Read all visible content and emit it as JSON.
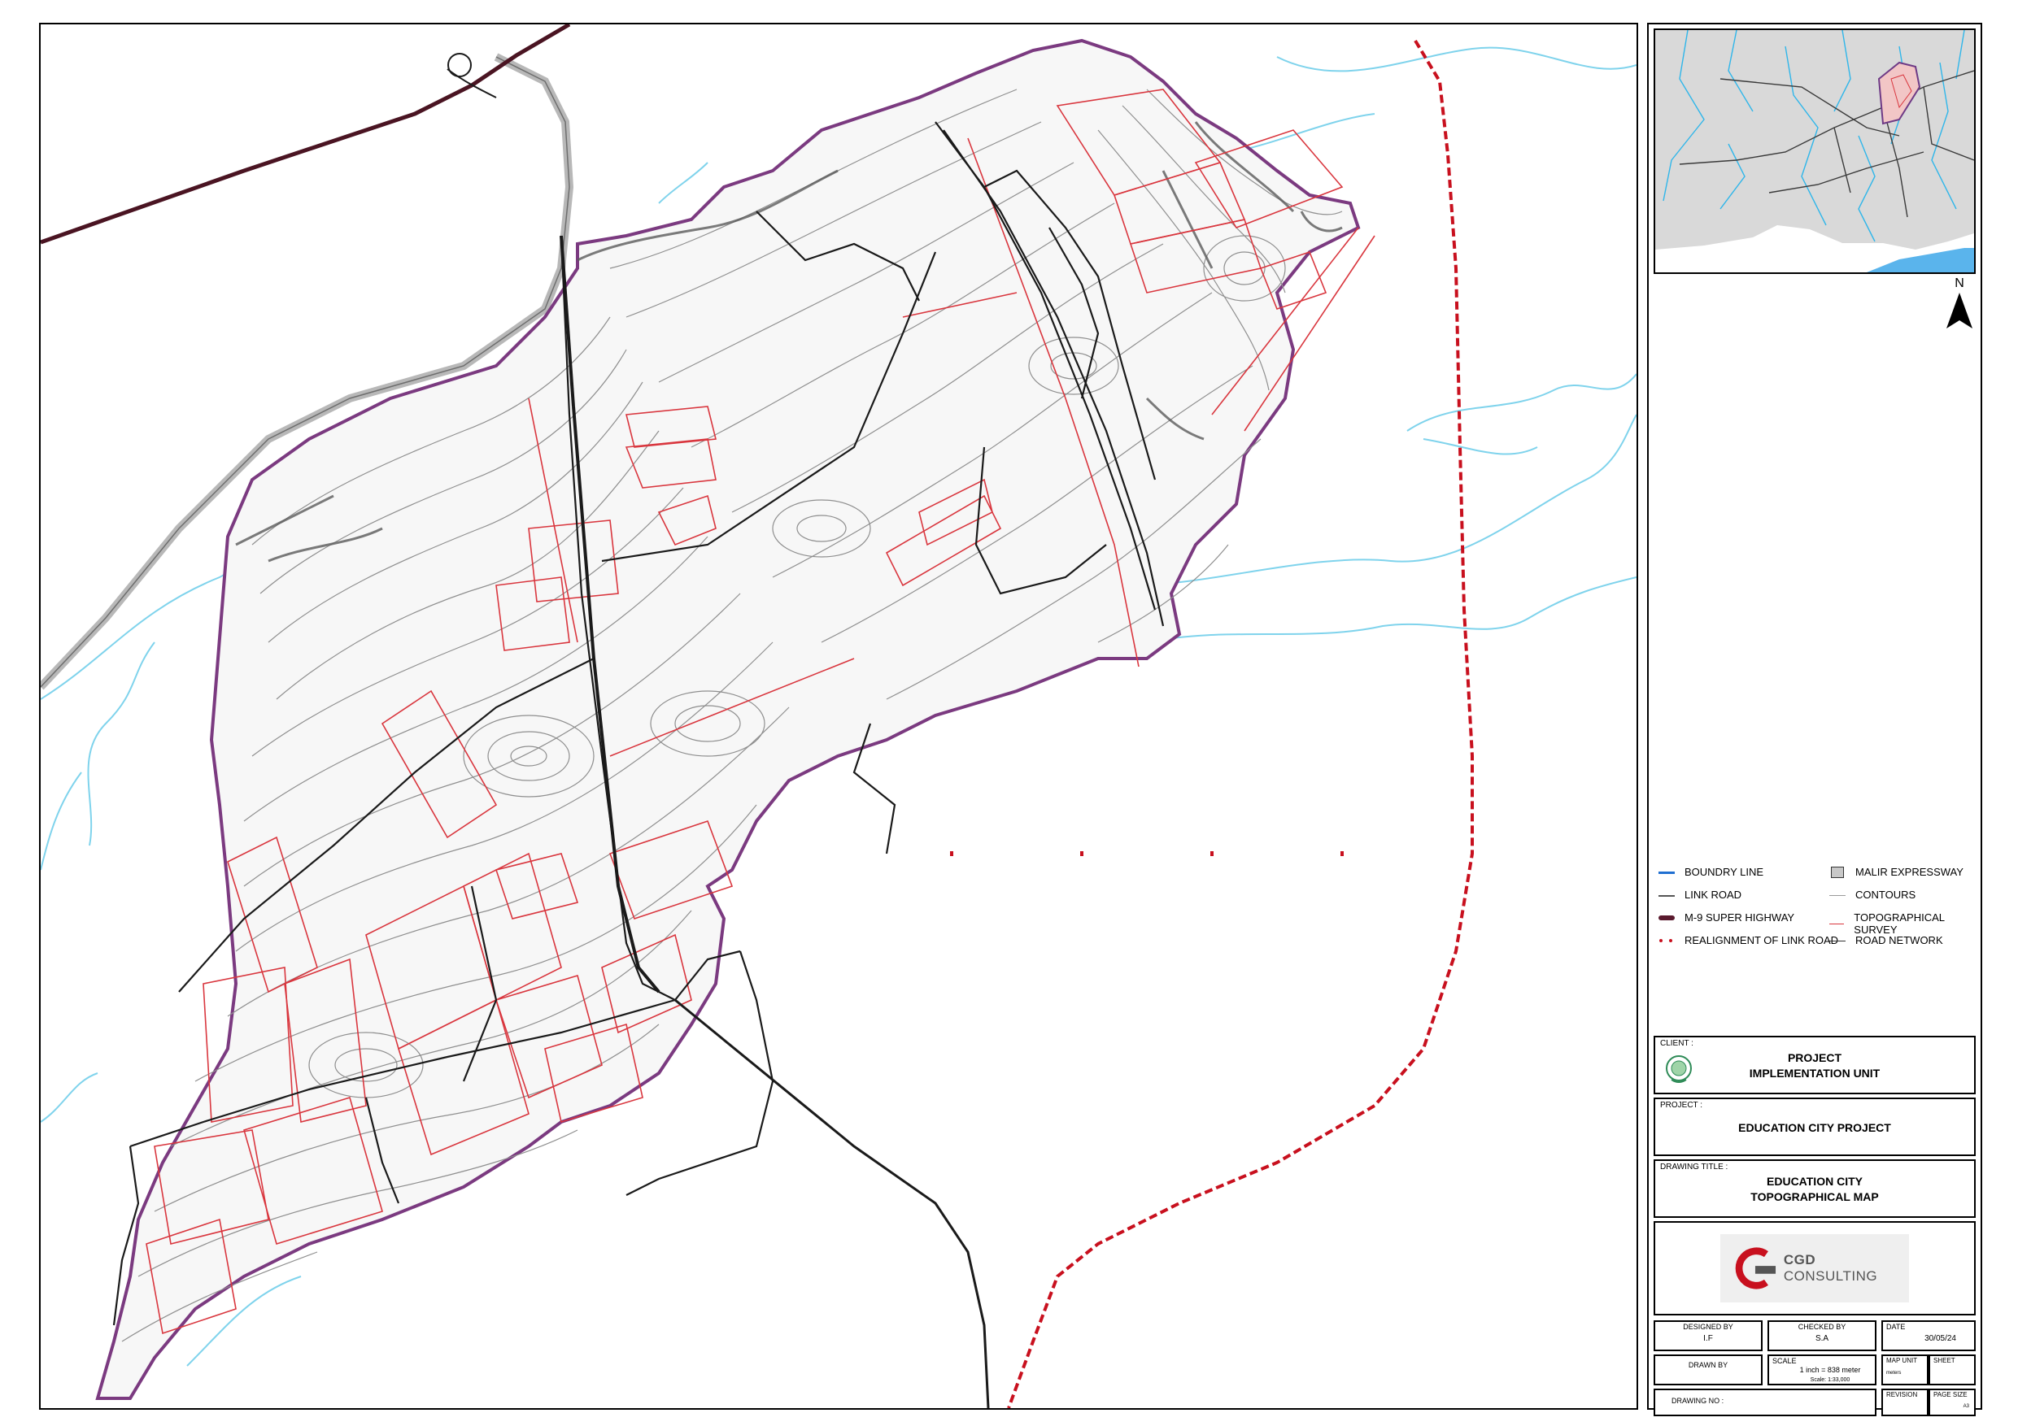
{
  "legend": [
    {
      "label": "BOUNDRY LINE",
      "symbol": "line",
      "color": "#1f6fd1"
    },
    {
      "label": "MALIR EXPRESSWAY",
      "symbol": "box",
      "color": "#c8c8c8"
    },
    {
      "label": "LINK ROAD",
      "symbol": "line",
      "color": "#555555"
    },
    {
      "label": "CONTOURS",
      "symbol": "line",
      "color": "#9a9a9a"
    },
    {
      "label": "M-9 SUPER HIGHWAY",
      "symbol": "thick",
      "color": "#5a1a2e"
    },
    {
      "label": "TOPOGRAPHICAL SURVEY",
      "symbol": "line",
      "color": "#d9363e"
    },
    {
      "label": "REALIGNMENT OF LINK ROAD",
      "symbol": "dots",
      "color": "#c8101e"
    },
    {
      "label": "ROAD NETWORK",
      "symbol": "line",
      "color": "#333333"
    }
  ],
  "north_arrow": {
    "letter": "N",
    "icon": "north-arrow-icon"
  },
  "title_block": {
    "client_caption": "CLIENT :",
    "client_name_line1": "PROJECT",
    "client_name_line2": "IMPLEMENTATION UNIT",
    "project_caption": "PROJECT :",
    "project_name": "EDUCATION CITY PROJECT",
    "drawing_title_caption": "DRAWING TITLE :",
    "drawing_title_line1": "EDUCATION CITY",
    "drawing_title_line2": "TOPOGRAPHICAL MAP",
    "consultant": {
      "mark": "CGD",
      "name": "CONSULTING"
    },
    "designed_by": {
      "label": "DESIGNED BY",
      "value": "I.F"
    },
    "checked_by": {
      "label": "CHECKED BY",
      "value": "S.A"
    },
    "date": {
      "label": "DATE",
      "value": "30/05/24"
    },
    "drawn_by": {
      "label": "DRAWN BY",
      "value": ""
    },
    "scale": {
      "label": "SCALE",
      "value": "1 inch = 838 meter",
      "sub": "Scale: 1:33,000"
    },
    "map_unit": {
      "label": "MAP UNIT",
      "value": "meters"
    },
    "sheet": {
      "label": "SHEET",
      "value": ""
    },
    "drawing_no": {
      "label": "DRAWING NO :",
      "value": ""
    },
    "revision": {
      "label": "REVISION",
      "value": ""
    },
    "page_size": {
      "label": "PAGE SIZE",
      "value": "A3"
    }
  },
  "colors": {
    "contour": "#8f8f8f",
    "boundary": "#7b3a80",
    "survey": "#d9363e",
    "road": "#1a1a1a",
    "highway": "#4a1422",
    "expressway": "#b8b8b8",
    "river": "#7fd3ec",
    "realignment": "#c8101e",
    "inset_land": "#d9d9d9",
    "inset_sea": "#5ab4ec"
  }
}
